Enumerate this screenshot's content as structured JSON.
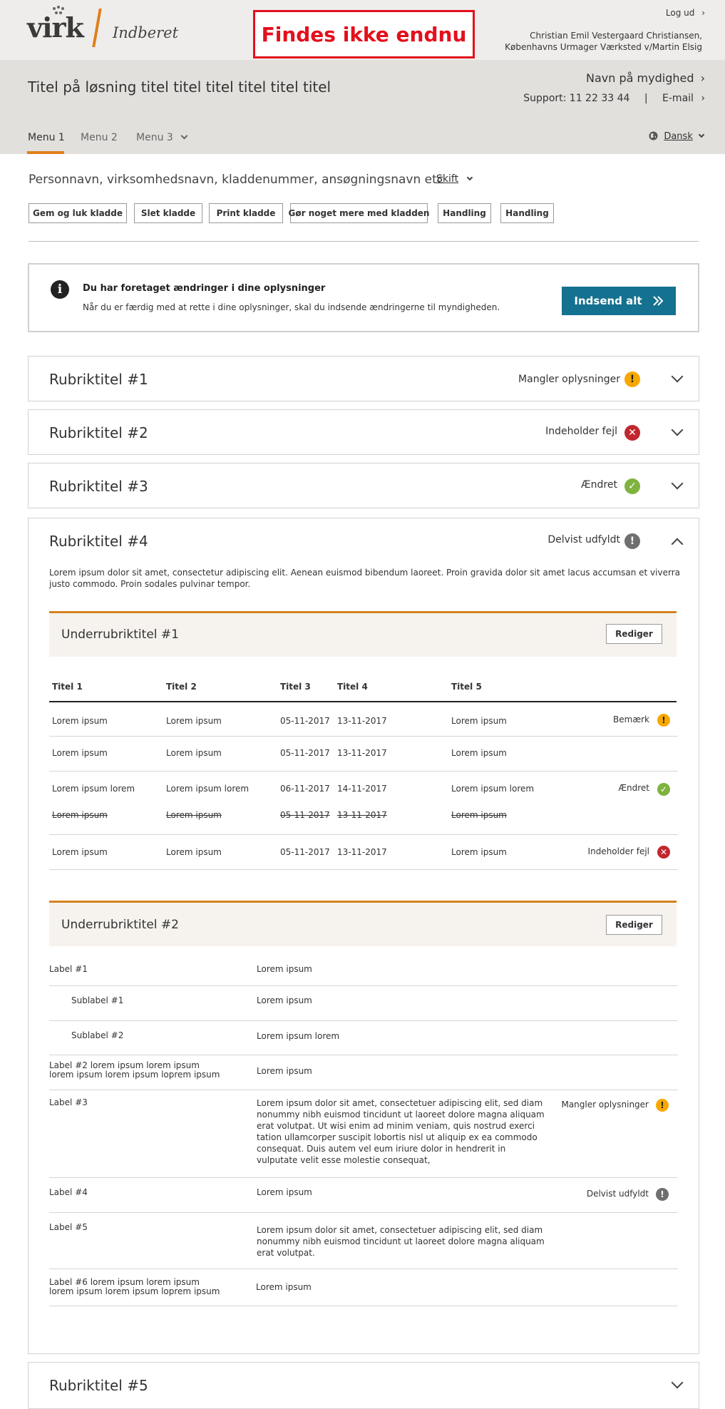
{
  "header": {
    "logo_text": "virk",
    "logo_subtitle": "Indberet",
    "banner": "Findes ikke endnu",
    "logout": "Log ud",
    "user_line1": "Christian Emil Vestergaard Christiansen,",
    "user_line2": "Københavns Urmager Værksted v/Martin Elsig",
    "authority": "Navn på mydighed",
    "support_label": "Support: 11 22 33 44",
    "separator": "|",
    "email_label": "E-mail",
    "solution_title": "Titel på løsning titel titel titel titel titel titel",
    "language": "Dansk"
  },
  "nav": {
    "items": [
      {
        "label": "Menu 1"
      },
      {
        "label": "Menu 2"
      },
      {
        "label": "Menu 3"
      }
    ]
  },
  "context": {
    "subject": "Personnavn, virksomhedsnavn, kladdenummer, ansøgningsnavn etc",
    "switch_label": "Skift"
  },
  "toolbar": {
    "buttons": [
      {
        "label": "Gem og luk kladde"
      },
      {
        "label": "Slet kladde"
      },
      {
        "label": "Print kladde"
      },
      {
        "label": "Gør noget mere med kladden"
      },
      {
        "label": "Handling"
      },
      {
        "label": "Handling"
      }
    ]
  },
  "notice": {
    "title": "Du har foretaget ændringer i dine oplysninger",
    "text": "Når du er færdig med at rette i dine oplysninger, skal du indsende ændringerne til myndigheden.",
    "submit_label": "Indsend alt"
  },
  "panels": [
    {
      "title": "Rubriktitel #1",
      "status": "Mangler oplysninger",
      "icon": "warning-icon"
    },
    {
      "title": "Rubriktitel #2",
      "status": "Indeholder fejl",
      "icon": "error-icon"
    },
    {
      "title": "Rubriktitel #3",
      "status": "Ændret",
      "icon": "check-icon"
    },
    {
      "title": "Rubriktitel #4",
      "status": "Delvist udfyldt",
      "icon": "partial-icon",
      "description": "Lorem ipsum dolor sit amet, consectetur adipiscing elit. Aenean euismod bibendum laoreet. Proin gravida dolor sit amet lacus accumsan et viverra justo commodo. Proin sodales pulvinar tempor."
    },
    {
      "title": "Rubriktitel #5"
    }
  ],
  "sub1": {
    "title": "Underrubriktitel #1",
    "edit_label": "Rediger",
    "columns": [
      "Titel 1",
      "Titel 2",
      "Titel 3",
      "Titel 4",
      "Titel 5"
    ],
    "rows": [
      {
        "cells": [
          "Lorem ipsum",
          "Lorem ipsum",
          "05-11-2017",
          "13-11-2017",
          "Lorem ipsum"
        ],
        "status": "Bemærk"
      },
      {
        "cells": [
          "Lorem ipsum",
          "Lorem ipsum",
          "05-11-2017",
          "13-11-2017",
          "Lorem ipsum"
        ],
        "status": ""
      },
      {
        "cells": [
          "Lorem ipsum lorem",
          "Lorem ipsum lorem",
          "06-11-2017",
          "14-11-2017",
          "Lorem ipsum lorem"
        ],
        "status": "Ændret",
        "old_cells": [
          "Lorem ipsum",
          "Lorem ipsum",
          "05-11-2017",
          "13-11-2017",
          "Lorem ipsum"
        ]
      },
      {
        "cells": [
          "Lorem ipsum",
          "Lorem ipsum",
          "05-11-2017",
          "13-11-2017",
          "Lorem ipsum"
        ],
        "status": "Indeholder fejl"
      }
    ]
  },
  "sub2": {
    "title": "Underrubriktitel #2",
    "edit_label": "Rediger",
    "rows": [
      {
        "label": "Label #1",
        "value": "Lorem ipsum"
      },
      {
        "label": "Sublabel #1",
        "value": "Lorem ipsum"
      },
      {
        "label": "Sublabel #2",
        "value": "Lorem ipsum lorem"
      },
      {
        "label": "Label #2 lorem ipsum lorem ipsum lorem ipsum lorem ipsum loprem ipsum",
        "value": "Lorem ipsum"
      },
      {
        "label": "Label #3",
        "value": "Lorem ipsum dolor sit amet, consectetuer adipiscing elit, sed diam nonummy nibh euismod tincidunt ut laoreet dolore magna aliquam erat volutpat. Ut wisi enim ad minim veniam, quis nostrud exerci tation ullamcorper suscipit lobortis nisl ut aliquip ex ea commodo consequat. Duis autem vel eum iriure dolor in hendrerit in vulputate velit esse molestie consequat,",
        "status": "Mangler oplysninger"
      },
      {
        "label": "Label #4",
        "value": "Lorem ipsum",
        "status": "Delvist udfyldt"
      },
      {
        "label": "Label #5",
        "value": "Lorem ipsum dolor sit amet, consectetuer adipiscing elit, sed diam nonummy nibh euismod tincidunt ut laoreet dolore magna aliquam erat volutpat."
      },
      {
        "label": "Label #6 lorem ipsum lorem ipsum lorem ipsum lorem ipsum loprem ipsum",
        "value": "Lorem ipsum"
      }
    ]
  },
  "colors": {
    "accent": "#e07f1a",
    "primary": "#14718f",
    "warning": "#f6a800",
    "error": "#c1272d",
    "success": "#7fb23f",
    "neutral": "#6f6f6f",
    "banner": "#e3101c"
  }
}
